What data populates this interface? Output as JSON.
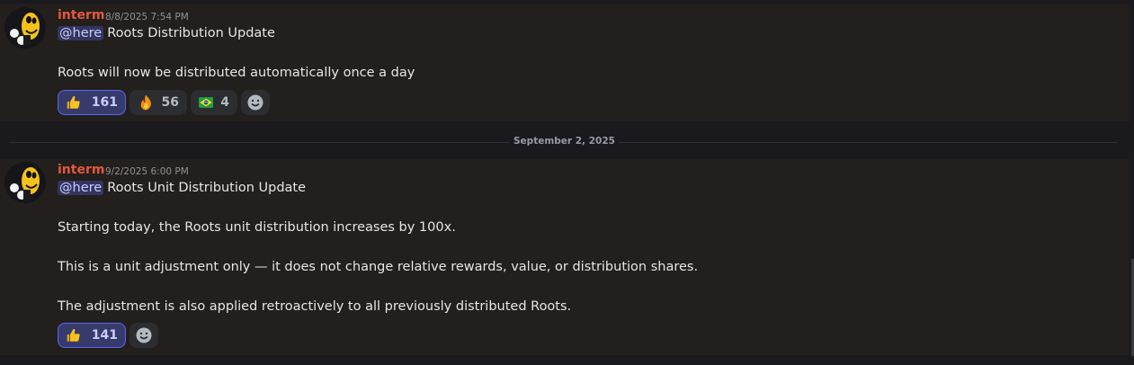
{
  "messages": [
    {
      "username": "interm",
      "timestamp": "8/8/2025 7:54 PM",
      "mention": "@here",
      "title": "Roots Distribution Update",
      "body": [
        "Roots will now be distributed automatically once a day"
      ],
      "reactions": [
        {
          "icon": "thumbs-up-icon",
          "count": "161",
          "active": true
        },
        {
          "icon": "fire-icon",
          "count": "56",
          "active": false
        },
        {
          "icon": "brazil-flag-icon",
          "count": "4",
          "active": false
        }
      ]
    },
    {
      "username": "interm",
      "timestamp": "9/2/2025 6:00 PM",
      "mention": "@here",
      "title": "Roots Unit Distribution Update",
      "body": [
        "Starting today, the Roots unit distribution increases by 100x.",
        "This is a unit adjustment only — it does not change relative rewards, value, or distribution shares.",
        "The adjustment is also applied retroactively to all previously distributed Roots."
      ],
      "reactions": [
        {
          "icon": "thumbs-up-icon",
          "count": "141",
          "active": true
        }
      ]
    }
  ],
  "date_divider": "September 2, 2025",
  "colors": {
    "username": "#e5573d",
    "mention_bg": "#3c4270",
    "reaction_active_border": "#5865f2",
    "message_bg": "#221f1c",
    "page_bg": "#1a1a1e"
  }
}
